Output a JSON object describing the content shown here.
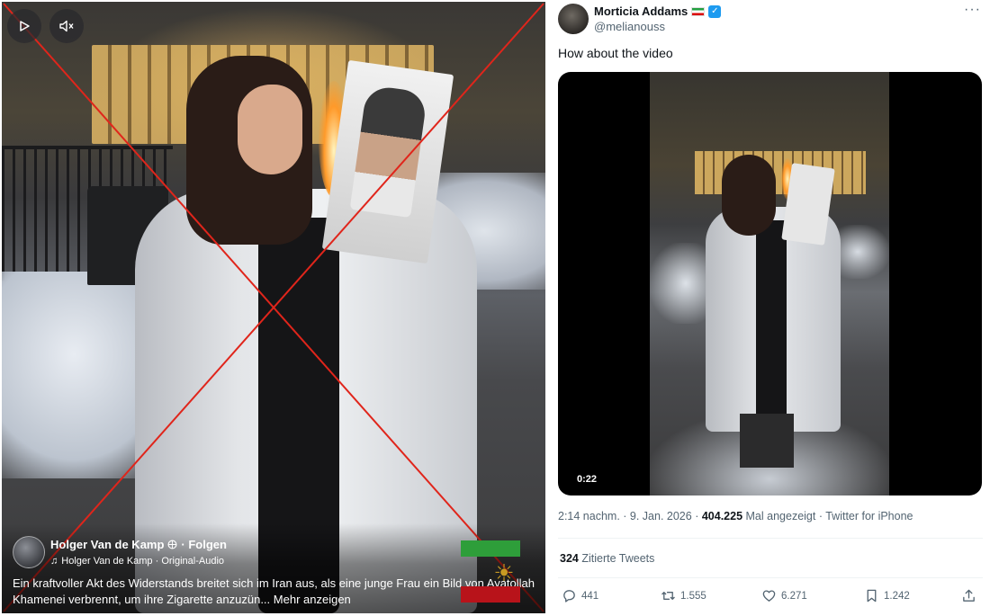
{
  "left_post": {
    "author": "Holger Van de Kamp",
    "follow_label": "· Folgen",
    "audio": "Holger Van de Kamp · Original-Audio",
    "caption": "Ein kraftvoller Akt des Widerstands breitet sich im Iran aus, als eine junge Frau ein Bild von Ayatollah Khamenei verbrennt, um ihre Zigarette anzuzün...",
    "more_label": "Mehr anzeigen",
    "controls": {
      "play_icon": "play-icon",
      "mute_icon": "muted-speaker-icon"
    },
    "cross_color": "#e0251b"
  },
  "tweet": {
    "display_name": "Morticia Addams",
    "handle": "@melianouss",
    "text": "How about the video",
    "video_duration": "0:22",
    "timestamp": "2:14 nachm. · 9. Jan. 2026",
    "views_count": "404.225",
    "views_label": "Mal angezeigt · Twitter for iPhone",
    "quote_count": "324",
    "quote_label": "Zitierte Tweets",
    "actions": {
      "replies": "441",
      "retweets": "1.555",
      "likes": "6.271",
      "bookmarks": "1.242"
    },
    "colors": {
      "verified": "#1d9bf0",
      "text": "#0f1419",
      "secondary": "#536471"
    }
  }
}
